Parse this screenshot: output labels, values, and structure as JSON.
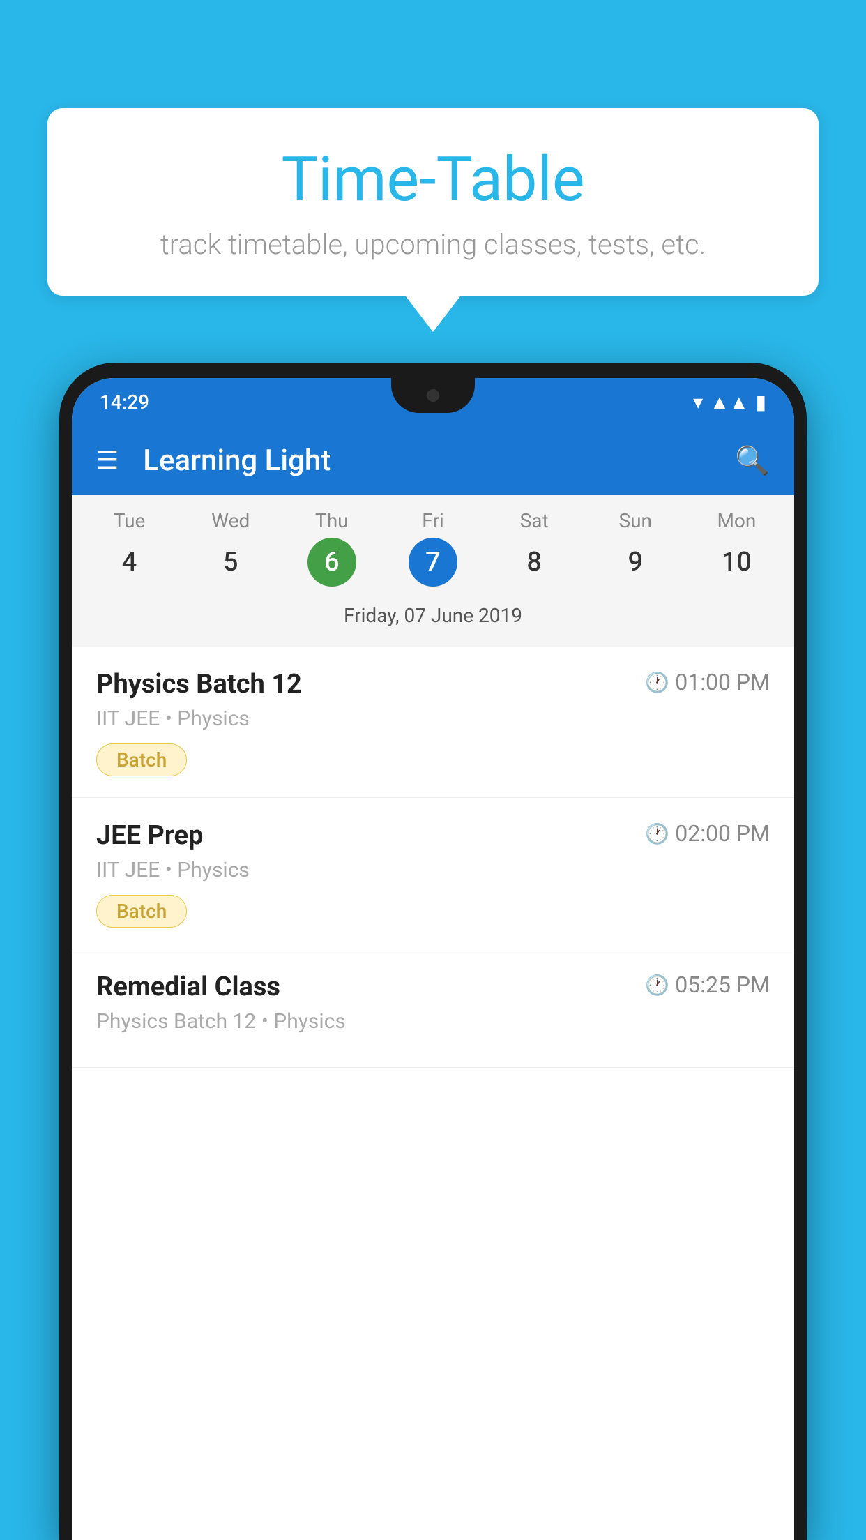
{
  "background_color": "#29b6e8",
  "bubble": {
    "title": "Time-Table",
    "subtitle": "track timetable, upcoming classes, tests, etc."
  },
  "phone": {
    "status_bar": {
      "time": "14:29"
    },
    "header": {
      "title": "Learning Light",
      "menu_label": "☰",
      "search_label": "🔍"
    },
    "calendar": {
      "days": [
        {
          "name": "Tue",
          "number": "4",
          "state": "normal"
        },
        {
          "name": "Wed",
          "number": "5",
          "state": "normal"
        },
        {
          "name": "Thu",
          "number": "6",
          "state": "today"
        },
        {
          "name": "Fri",
          "number": "7",
          "state": "selected"
        },
        {
          "name": "Sat",
          "number": "8",
          "state": "normal"
        },
        {
          "name": "Sun",
          "number": "9",
          "state": "normal"
        },
        {
          "name": "Mon",
          "number": "10",
          "state": "normal"
        }
      ],
      "selected_date_label": "Friday, 07 June 2019"
    },
    "schedule": [
      {
        "title": "Physics Batch 12",
        "time": "01:00 PM",
        "subtitle": "IIT JEE • Physics",
        "tag": "Batch"
      },
      {
        "title": "JEE Prep",
        "time": "02:00 PM",
        "subtitle": "IIT JEE • Physics",
        "tag": "Batch"
      },
      {
        "title": "Remedial Class",
        "time": "05:25 PM",
        "subtitle": "Physics Batch 12 • Physics",
        "tag": null
      }
    ]
  }
}
